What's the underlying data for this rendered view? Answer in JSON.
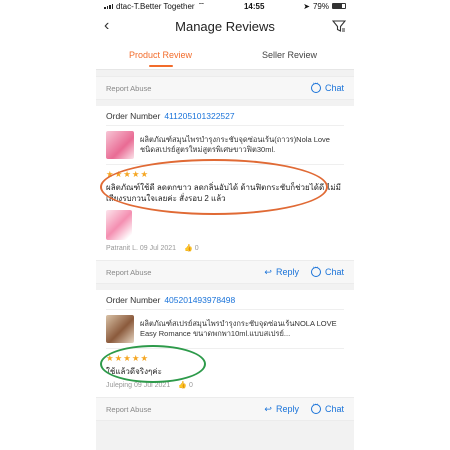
{
  "status": {
    "carrier": "dtac-T.Better Together",
    "time": "14:55",
    "battery": "79%"
  },
  "header": {
    "title": "Manage Reviews"
  },
  "tabs": [
    {
      "label": "Product Review"
    },
    {
      "label": "Seller Review"
    }
  ],
  "actions": {
    "report": "Report Abuse",
    "reply": "Reply",
    "chat": "Chat"
  },
  "reviews": [
    {
      "order_label": "Order Number",
      "order_number": "411205101322527",
      "product": "ผลิตภัณฑ์สมุนไพรบำรุงกระชับจุดซ่อนเร้น(ถาวร)Nola Love ชนิดสเปรย์สูตรใหม่สูตรพิเศษขาวฟิต30ml.",
      "rating": 5,
      "text": "ผลิตภัณฑ์ใช้ดี ลดตกขาว ลดกลิ่นอับได้ ด้านฟิตกระชับก็ช่วยได้ดี ไม่มีเสียงรบกวนใจเลยค่ะ สั่งรอบ 2 แล้ว",
      "author_date": "Patranit L. 09 Jul 2021",
      "likes": "0"
    },
    {
      "order_label": "Order Number",
      "order_number": "405201493978498",
      "product": "ผลิตภัณฑ์สเปรย์สมุนไพรบำรุงกระชับจุดซ่อนเร้นNOLA LOVE Easy Romance ขนาดพกพา10ml.แบบสเปรย์...",
      "rating": 5,
      "text": "ใช้แล้วดีจริงๆค่ะ",
      "author_date": "Juleping 09 Jul 2021",
      "likes": "0"
    }
  ]
}
